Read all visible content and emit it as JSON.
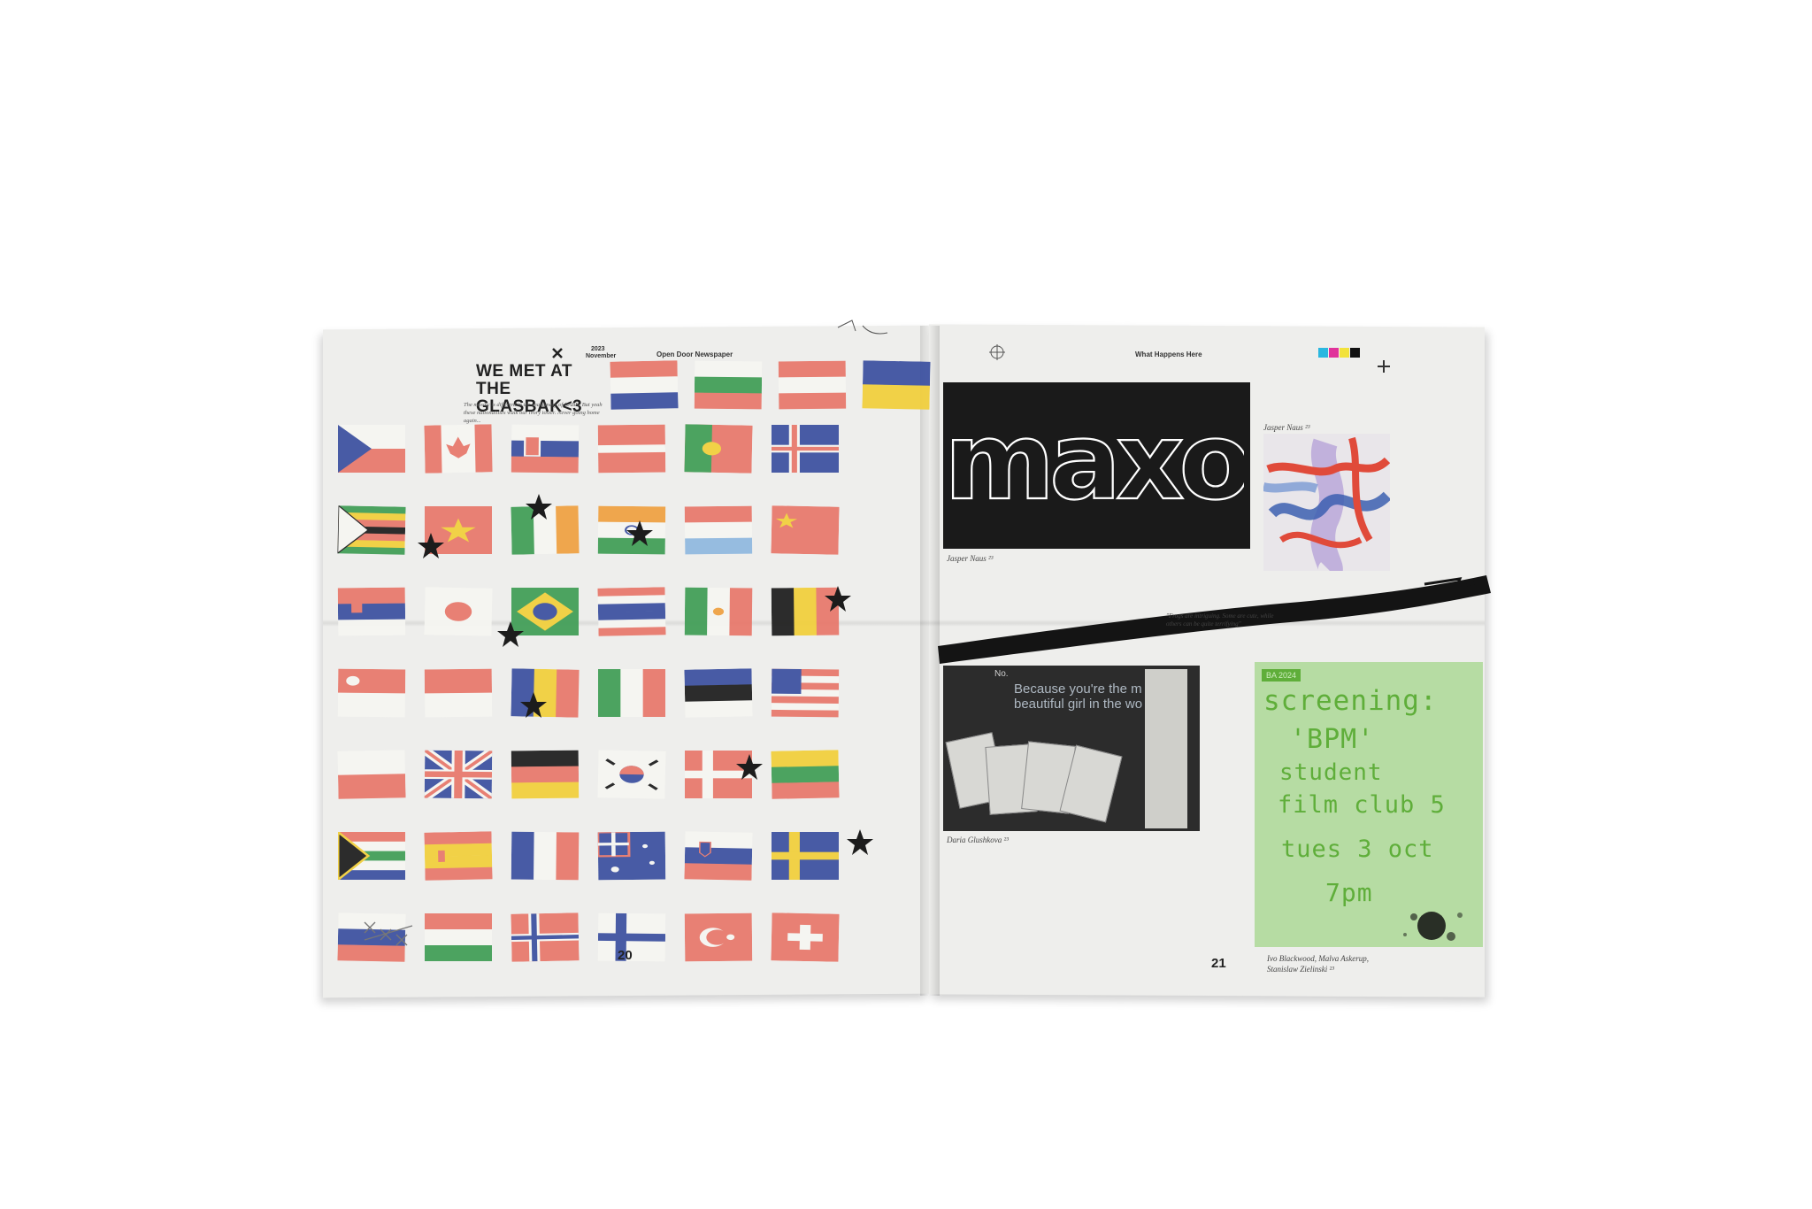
{
  "left_page": {
    "header_date_top": "2023",
    "header_date_month": "November",
    "header_masthead": "Open Door Newspaper",
    "headline_line1": "WE MET AT THE",
    "headline_line2": "GLASBAK<3",
    "intro_text": "The mosaic is different in the shakeaway of KABK. But yeah these nationalities walk our ivory tower. Never going home again...",
    "folio": "20",
    "flag_rows": [
      [
        "netherlands",
        "bulgaria",
        "austria",
        "ukraine"
      ],
      [
        "czech",
        "canada",
        "slovakia",
        "latvia",
        "portugal",
        "iceland"
      ],
      [
        "zimbabwe",
        "vietnam",
        "ireland",
        "india",
        "luxembourg",
        "china"
      ],
      [
        "serbia",
        "japan",
        "brazil",
        "thailand",
        "mexico",
        "belgium"
      ],
      [
        "singapore",
        "indonesia",
        "romania",
        "italy",
        "estonia",
        "usa"
      ],
      [
        "poland",
        "uk",
        "germany",
        "korea",
        "denmark",
        "lithuania"
      ],
      [
        "south-africa",
        "spain",
        "france",
        "australia",
        "slovenia",
        "sweden"
      ],
      [
        "russia",
        "hungary",
        "norway",
        "finland",
        "turkey",
        "switzerland"
      ]
    ]
  },
  "right_page": {
    "running_head": "What Happens Here",
    "maxo_word": "maxo",
    "caption_jasper_1": "Jasper Naus ²³",
    "caption_jasper_2": "Jasper Naus ²³",
    "quote_text": "\"Frogs are intriguing. Some are cute, while others can be quite terrifying\"",
    "photo_text_no": "No.",
    "photo_text_line1": "Because you're the m",
    "photo_text_line2": "beautiful girl in the wo",
    "caption_daria": "Daria Glushkova ²³",
    "poster": {
      "tag": "BA 2024",
      "line1": "screening:",
      "line2": "'BPM'",
      "line3": "student",
      "line4": "film club 5",
      "line5": "tues 3 oct",
      "line6": "7pm"
    },
    "caption_ivo_line1": "Ivo Blackwood, Malva Askerup,",
    "caption_ivo_line2": "Stanislaw Zielinski ²³",
    "folio": "21"
  },
  "colors": {
    "paper": "#eeeeec",
    "ink": "#1a1a1a",
    "poster_green": "#5fae3a",
    "poster_bg": "#b6dca3",
    "crayon_red": "#e8776a",
    "crayon_blue": "#3a4fa0",
    "crayon_yellow": "#f2cf3a",
    "crayon_green": "#3f9d55"
  }
}
